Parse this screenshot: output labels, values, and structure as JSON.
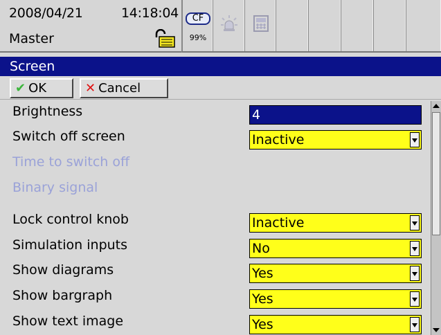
{
  "status": {
    "date": "2008/04/21",
    "time": "14:18:04",
    "user": "Master",
    "cf_label": "CF",
    "cf_usage": "99%"
  },
  "title": "Screen",
  "buttons": {
    "ok": "OK",
    "cancel": "Cancel"
  },
  "form": {
    "rows": [
      {
        "label": "Brightness",
        "value": "4",
        "enabled": true,
        "type": "input"
      },
      {
        "label": "Switch off screen",
        "value": "Inactive",
        "enabled": true,
        "type": "select"
      },
      {
        "label": "Time to switch off",
        "value": "",
        "enabled": false,
        "type": "none"
      },
      {
        "label": "Binary signal",
        "value": "",
        "enabled": false,
        "type": "none"
      },
      {
        "label": "Lock control knob",
        "value": "Inactive",
        "enabled": true,
        "type": "select"
      },
      {
        "label": "Simulation inputs",
        "value": "No",
        "enabled": true,
        "type": "select"
      },
      {
        "label": "Show diagrams",
        "value": "Yes",
        "enabled": true,
        "type": "select"
      },
      {
        "label": "Show bargraph",
        "value": "Yes",
        "enabled": true,
        "type": "select"
      },
      {
        "label": "Show text image",
        "value": "Yes",
        "enabled": true,
        "type": "select"
      }
    ]
  },
  "colors": {
    "title_bg": "#0b128a",
    "field_bg": "#ffff1a",
    "disabled_text": "#9aa2d8",
    "ok_check": "#3bb53b",
    "cancel_x": "#e01010"
  }
}
